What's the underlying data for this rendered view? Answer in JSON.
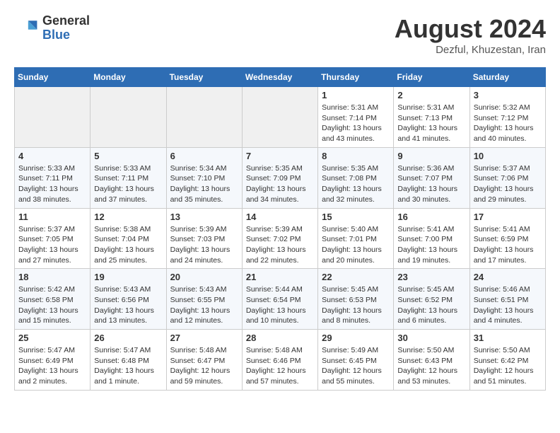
{
  "header": {
    "title": "August 2024",
    "subtitle": "Dezful, Khuzestan, Iran",
    "logo_general": "General",
    "logo_blue": "Blue"
  },
  "days_of_week": [
    "Sunday",
    "Monday",
    "Tuesday",
    "Wednesday",
    "Thursday",
    "Friday",
    "Saturday"
  ],
  "weeks": [
    [
      {
        "day": "",
        "info": ""
      },
      {
        "day": "",
        "info": ""
      },
      {
        "day": "",
        "info": ""
      },
      {
        "day": "",
        "info": ""
      },
      {
        "day": "1",
        "info": "Sunrise: 5:31 AM\nSunset: 7:14 PM\nDaylight: 13 hours\nand 43 minutes."
      },
      {
        "day": "2",
        "info": "Sunrise: 5:31 AM\nSunset: 7:13 PM\nDaylight: 13 hours\nand 41 minutes."
      },
      {
        "day": "3",
        "info": "Sunrise: 5:32 AM\nSunset: 7:12 PM\nDaylight: 13 hours\nand 40 minutes."
      }
    ],
    [
      {
        "day": "4",
        "info": "Sunrise: 5:33 AM\nSunset: 7:11 PM\nDaylight: 13 hours\nand 38 minutes."
      },
      {
        "day": "5",
        "info": "Sunrise: 5:33 AM\nSunset: 7:11 PM\nDaylight: 13 hours\nand 37 minutes."
      },
      {
        "day": "6",
        "info": "Sunrise: 5:34 AM\nSunset: 7:10 PM\nDaylight: 13 hours\nand 35 minutes."
      },
      {
        "day": "7",
        "info": "Sunrise: 5:35 AM\nSunset: 7:09 PM\nDaylight: 13 hours\nand 34 minutes."
      },
      {
        "day": "8",
        "info": "Sunrise: 5:35 AM\nSunset: 7:08 PM\nDaylight: 13 hours\nand 32 minutes."
      },
      {
        "day": "9",
        "info": "Sunrise: 5:36 AM\nSunset: 7:07 PM\nDaylight: 13 hours\nand 30 minutes."
      },
      {
        "day": "10",
        "info": "Sunrise: 5:37 AM\nSunset: 7:06 PM\nDaylight: 13 hours\nand 29 minutes."
      }
    ],
    [
      {
        "day": "11",
        "info": "Sunrise: 5:37 AM\nSunset: 7:05 PM\nDaylight: 13 hours\nand 27 minutes."
      },
      {
        "day": "12",
        "info": "Sunrise: 5:38 AM\nSunset: 7:04 PM\nDaylight: 13 hours\nand 25 minutes."
      },
      {
        "day": "13",
        "info": "Sunrise: 5:39 AM\nSunset: 7:03 PM\nDaylight: 13 hours\nand 24 minutes."
      },
      {
        "day": "14",
        "info": "Sunrise: 5:39 AM\nSunset: 7:02 PM\nDaylight: 13 hours\nand 22 minutes."
      },
      {
        "day": "15",
        "info": "Sunrise: 5:40 AM\nSunset: 7:01 PM\nDaylight: 13 hours\nand 20 minutes."
      },
      {
        "day": "16",
        "info": "Sunrise: 5:41 AM\nSunset: 7:00 PM\nDaylight: 13 hours\nand 19 minutes."
      },
      {
        "day": "17",
        "info": "Sunrise: 5:41 AM\nSunset: 6:59 PM\nDaylight: 13 hours\nand 17 minutes."
      }
    ],
    [
      {
        "day": "18",
        "info": "Sunrise: 5:42 AM\nSunset: 6:58 PM\nDaylight: 13 hours\nand 15 minutes."
      },
      {
        "day": "19",
        "info": "Sunrise: 5:43 AM\nSunset: 6:56 PM\nDaylight: 13 hours\nand 13 minutes."
      },
      {
        "day": "20",
        "info": "Sunrise: 5:43 AM\nSunset: 6:55 PM\nDaylight: 13 hours\nand 12 minutes."
      },
      {
        "day": "21",
        "info": "Sunrise: 5:44 AM\nSunset: 6:54 PM\nDaylight: 13 hours\nand 10 minutes."
      },
      {
        "day": "22",
        "info": "Sunrise: 5:45 AM\nSunset: 6:53 PM\nDaylight: 13 hours\nand 8 minutes."
      },
      {
        "day": "23",
        "info": "Sunrise: 5:45 AM\nSunset: 6:52 PM\nDaylight: 13 hours\nand 6 minutes."
      },
      {
        "day": "24",
        "info": "Sunrise: 5:46 AM\nSunset: 6:51 PM\nDaylight: 13 hours\nand 4 minutes."
      }
    ],
    [
      {
        "day": "25",
        "info": "Sunrise: 5:47 AM\nSunset: 6:49 PM\nDaylight: 13 hours\nand 2 minutes."
      },
      {
        "day": "26",
        "info": "Sunrise: 5:47 AM\nSunset: 6:48 PM\nDaylight: 13 hours\nand 1 minute."
      },
      {
        "day": "27",
        "info": "Sunrise: 5:48 AM\nSunset: 6:47 PM\nDaylight: 12 hours\nand 59 minutes."
      },
      {
        "day": "28",
        "info": "Sunrise: 5:48 AM\nSunset: 6:46 PM\nDaylight: 12 hours\nand 57 minutes."
      },
      {
        "day": "29",
        "info": "Sunrise: 5:49 AM\nSunset: 6:45 PM\nDaylight: 12 hours\nand 55 minutes."
      },
      {
        "day": "30",
        "info": "Sunrise: 5:50 AM\nSunset: 6:43 PM\nDaylight: 12 hours\nand 53 minutes."
      },
      {
        "day": "31",
        "info": "Sunrise: 5:50 AM\nSunset: 6:42 PM\nDaylight: 12 hours\nand 51 minutes."
      }
    ]
  ]
}
